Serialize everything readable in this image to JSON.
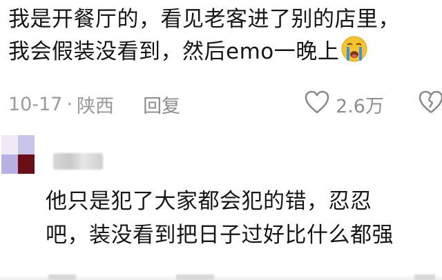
{
  "comment": {
    "lines": [
      "我是开餐厅的，看见老客进了别的店里，",
      "我会假装没看到，然后emo一晚上"
    ],
    "emoji": "crying-face-icon",
    "date": "10-17",
    "separator": "·",
    "location": "陕西",
    "reply_label": "回复",
    "like_count": "2.6万"
  },
  "reply_comment": {
    "lines": [
      "他只是犯了大家都会犯的错，忍忍",
      "吧，装没看到把日子过好比什么都强"
    ]
  },
  "colors": {
    "text": "#161616",
    "meta_gray": "#9a9a9a",
    "emoji_yellow": "#f7c22e",
    "tear_blue": "#3d8fe0",
    "avatar_purple": "#b6b1e0",
    "avatar_dark_red": "#6b0f17"
  }
}
